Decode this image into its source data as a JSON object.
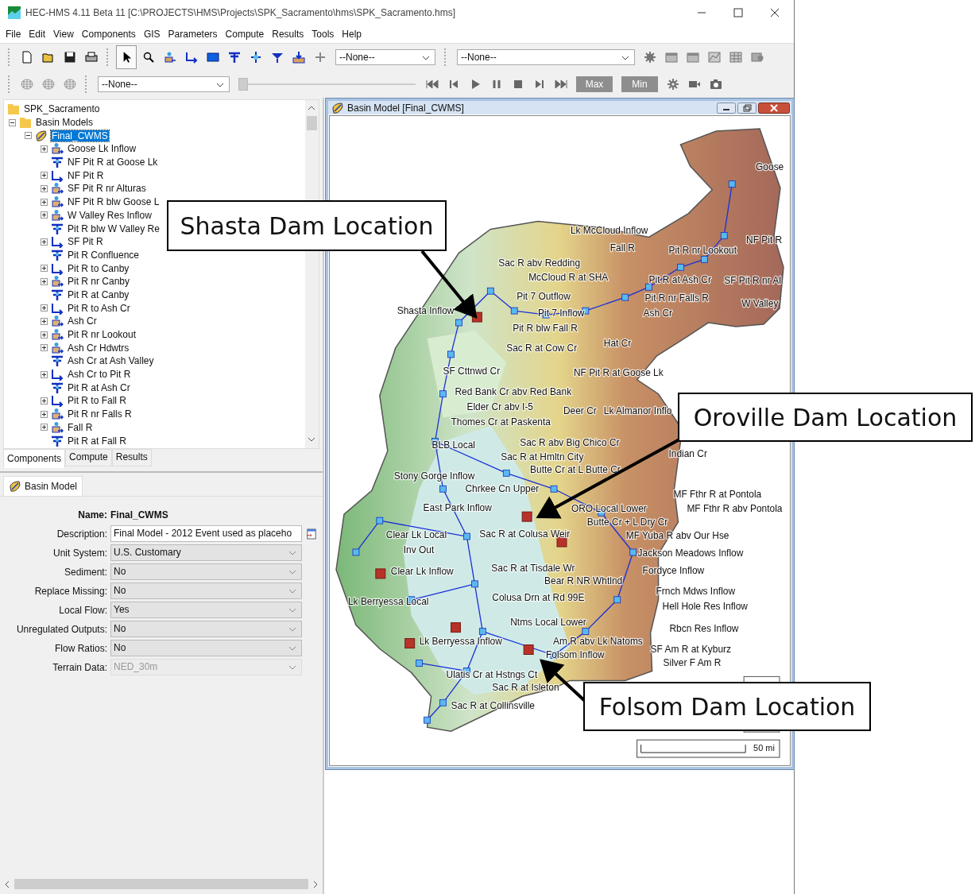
{
  "window": {
    "title": "HEC-HMS 4.11 Beta 11 [C:\\PROJECTS\\HMS\\Projects\\SPK_Sacramento\\hms\\SPK_Sacramento.hms]"
  },
  "menu": [
    "File",
    "Edit",
    "View",
    "Components",
    "GIS",
    "Parameters",
    "Compute",
    "Results",
    "Tools",
    "Help"
  ],
  "toolbar": {
    "selects": [
      "--None--",
      "--None--",
      "--None--"
    ],
    "time_slider": {
      "level": 0
    },
    "buttons": [
      {
        "label": "Max",
        "disabled": true
      },
      {
        "label": "Min",
        "disabled": true
      }
    ]
  },
  "tree": [
    {
      "label": "SPK_Sacramento",
      "selected": false,
      "children": [
        {
          "label": "Basin Models",
          "selected": false,
          "expanded": true,
          "children": [
            {
              "label": "Final_CWMS",
              "selected": true,
              "expanded": true,
              "children": [
                {
                  "label": "Goose Lk Inflow",
                  "kind": "subbasin",
                  "expandable": true,
                  "selected": false
                },
                {
                  "label": "NF Pit R at Goose Lk",
                  "kind": "junction",
                  "expandable": false,
                  "selected": false
                },
                {
                  "label": "NF Pit R",
                  "kind": "reach",
                  "expandable": true,
                  "selected": false
                },
                {
                  "label": "SF Pit R nr Alturas",
                  "kind": "subbasin",
                  "expandable": true,
                  "selected": false
                },
                {
                  "label": "NF Pit R blw Goose L",
                  "kind": "subbasin",
                  "expandable": true,
                  "selected": false
                },
                {
                  "label": "W Valley Res Inflow",
                  "kind": "subbasin",
                  "expandable": true,
                  "selected": false
                },
                {
                  "label": "Pit R blw W Valley Re",
                  "kind": "junction",
                  "expandable": false,
                  "selected": false
                },
                {
                  "label": "SF Pit R",
                  "kind": "reach",
                  "expandable": true,
                  "selected": false
                },
                {
                  "label": "Pit R Confluence",
                  "kind": "junction",
                  "expandable": false,
                  "selected": false
                },
                {
                  "label": "Pit R to Canby",
                  "kind": "reach",
                  "expandable": true,
                  "selected": false
                },
                {
                  "label": "Pit R nr Canby",
                  "kind": "subbasin",
                  "expandable": true,
                  "selected": false
                },
                {
                  "label": "Pit R at Canby",
                  "kind": "junction",
                  "expandable": false,
                  "selected": false
                },
                {
                  "label": "Pit R to Ash Cr",
                  "kind": "reach",
                  "expandable": true,
                  "selected": false
                },
                {
                  "label": "Ash Cr",
                  "kind": "subbasin",
                  "expandable": true,
                  "selected": false
                },
                {
                  "label": "Pit R nr Lookout",
                  "kind": "subbasin",
                  "expandable": true,
                  "selected": false
                },
                {
                  "label": "Ash Cr Hdwtrs",
                  "kind": "subbasin",
                  "expandable": true,
                  "selected": false
                },
                {
                  "label": "Ash Cr at Ash Valley",
                  "kind": "junction",
                  "expandable": false,
                  "selected": false
                },
                {
                  "label": "Ash Cr to Pit R",
                  "kind": "reach",
                  "expandable": true,
                  "selected": false
                },
                {
                  "label": "Pit R at Ash Cr",
                  "kind": "junction",
                  "expandable": false,
                  "selected": false
                },
                {
                  "label": "Pit R to Fall R",
                  "kind": "reach",
                  "expandable": true,
                  "selected": false
                },
                {
                  "label": "Pit R nr Falls R",
                  "kind": "subbasin",
                  "expandable": true,
                  "selected": false
                },
                {
                  "label": "Fall R",
                  "kind": "subbasin",
                  "expandable": true,
                  "selected": false
                },
                {
                  "label": "Pit R at Fall R",
                  "kind": "junction",
                  "expandable": false,
                  "selected": false
                }
              ]
            }
          ]
        }
      ]
    }
  ],
  "panel_tabs": [
    {
      "label": "Components",
      "selected": true
    },
    {
      "label": "Compute",
      "selected": false
    },
    {
      "label": "Results",
      "selected": false
    }
  ],
  "properties": {
    "tab": {
      "label": "Basin Model",
      "selected": true
    },
    "name_label": "Name:",
    "name_value": "Final_CWMS",
    "fields": [
      {
        "label": "Description:",
        "kind": "text",
        "value": "Final Model - 2012 Event used as placeho",
        "disabled": false
      },
      {
        "label": "Unit System:",
        "kind": "select",
        "value": "U.S. Customary",
        "disabled": false
      },
      {
        "label": "Sediment:",
        "kind": "select",
        "value": "No",
        "disabled": false
      },
      {
        "label": "Replace Missing:",
        "kind": "select",
        "value": "No",
        "disabled": false
      },
      {
        "label": "Local Flow:",
        "kind": "select",
        "value": "Yes",
        "disabled": false
      },
      {
        "label": "Unregulated Outputs:",
        "kind": "select",
        "value": "No",
        "disabled": false
      },
      {
        "label": "Flow Ratios:",
        "kind": "select",
        "value": "No",
        "disabled": false
      },
      {
        "label": "Terrain Data:",
        "kind": "select",
        "value": "NED_30m",
        "disabled": true
      }
    ]
  },
  "map_window": {
    "title": "Basin Model [Final_CWMS]",
    "scale": "50 mi",
    "labels": [
      "Goose",
      "Lk McCloud Inflow",
      "NF Pit R",
      "Fall R",
      "Pit R nr Lookout",
      "Sac R abv Redding",
      "McCloud R at SHA",
      "Pit R at Ash Cr",
      "SF Pit R nr Al",
      "Pit 7 Outflow",
      "Pit R nr Falls R",
      "W Valley",
      "Shasta Inflow",
      "Pit 7 Inflow",
      "Ash Cr",
      "Pit R blw Fall R",
      "Hat Cr",
      "Sac R at Cow Cr",
      "SF Cttnwd Cr",
      "NF Pit R at Goose Lk",
      "Red Bank Cr abv Red Bank",
      "Elder Cr abv I-5",
      "Deer Cr",
      "Lk Almanor Inflo",
      "Thomes Cr at Paskenta",
      "BLB Local",
      "Sac R abv Big Chico Cr",
      "Indian Cr",
      "Sac R at Hmltn City",
      "Butte Cr at L Butte Cr",
      "Stony Gorge Inflow",
      "Chrkee Cn Upper",
      "MF Fthr R at Pontola",
      "East Park Inflow",
      "ORO Local Lower",
      "MF Fthr R abv Pontola",
      "Butte Cr + L Dry Cr",
      "Clear Lk Local",
      "Sac R at Colusa Weir",
      "MF Yuba R abv Our Hse",
      "Inv Out",
      "Jackson Meadows Inflow",
      "Clear Lk Inflow",
      "Sac R at Tisdale Wr",
      "Fordyce Inflow",
      "Bear R NR Whtlnd",
      "Frnch Mdws Inflow",
      "Lk Berryessa Local",
      "Colusa Drn at Rd 99E",
      "Hell Hole Res Inflow",
      "Ntms Local Lower",
      "Rbcn Res Inflow",
      "Lk Berryessa Inflow",
      "Am R abv Lk Natoms",
      "SF Am R at Kyburz",
      "Folsom Inflow",
      "Silver F Am R",
      "Ulatis Cr at Hstngs Ct",
      "Sac R at Isleton",
      "Sac R at Collinsville"
    ]
  },
  "callouts": [
    {
      "text": "Shasta Dam Location"
    },
    {
      "text": "Oroville Dam Location"
    },
    {
      "text": "Folsom Dam Location"
    }
  ]
}
